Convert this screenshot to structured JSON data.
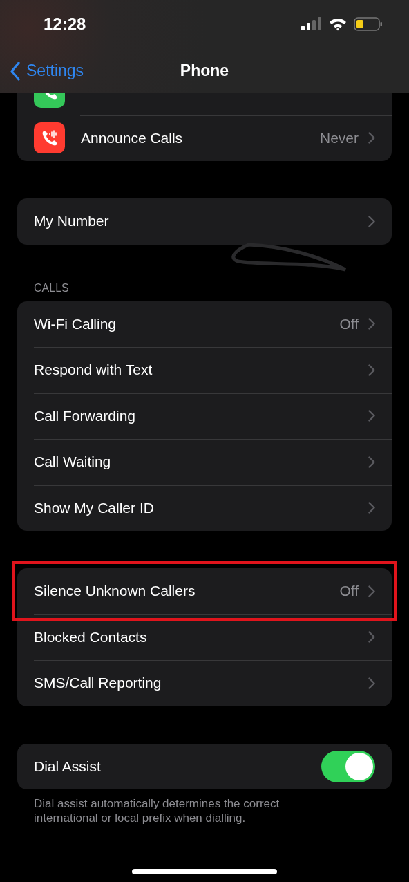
{
  "status_bar": {
    "time": "12:28"
  },
  "nav": {
    "back": "Settings",
    "title": "Phone"
  },
  "groups": [
    {
      "rows": [
        {
          "kind": "icon",
          "color": "#34c759"
        },
        {
          "kind": "icon",
          "color": "#ff3b30",
          "label": "Announce Calls",
          "value": "Never"
        }
      ]
    },
    {
      "rows": [
        {
          "kind": "link",
          "label": "My Number"
        }
      ]
    },
    {
      "header": "CALLS",
      "rows": [
        {
          "kind": "link",
          "label": "Wi-Fi Calling",
          "value": "Off"
        },
        {
          "kind": "link",
          "label": "Respond with Text"
        },
        {
          "kind": "link",
          "label": "Call Forwarding"
        },
        {
          "kind": "link",
          "label": "Call Waiting"
        },
        {
          "kind": "link",
          "label": "Show My Caller ID"
        }
      ]
    },
    {
      "rows": [
        {
          "kind": "link",
          "label": "Silence Unknown Callers",
          "value": "Off",
          "highlighted": true
        },
        {
          "kind": "link",
          "label": "Blocked Contacts",
          "highlighted": false
        },
        {
          "kind": "link",
          "label": "SMS/Call Reporting",
          "highlighted": false
        }
      ]
    },
    {
      "footer": "Dial assist automatically determines the correct international or local prefix when dialling.",
      "rows": [
        {
          "kind": "toggle",
          "label": "Dial Assist",
          "on": true
        }
      ]
    }
  ]
}
